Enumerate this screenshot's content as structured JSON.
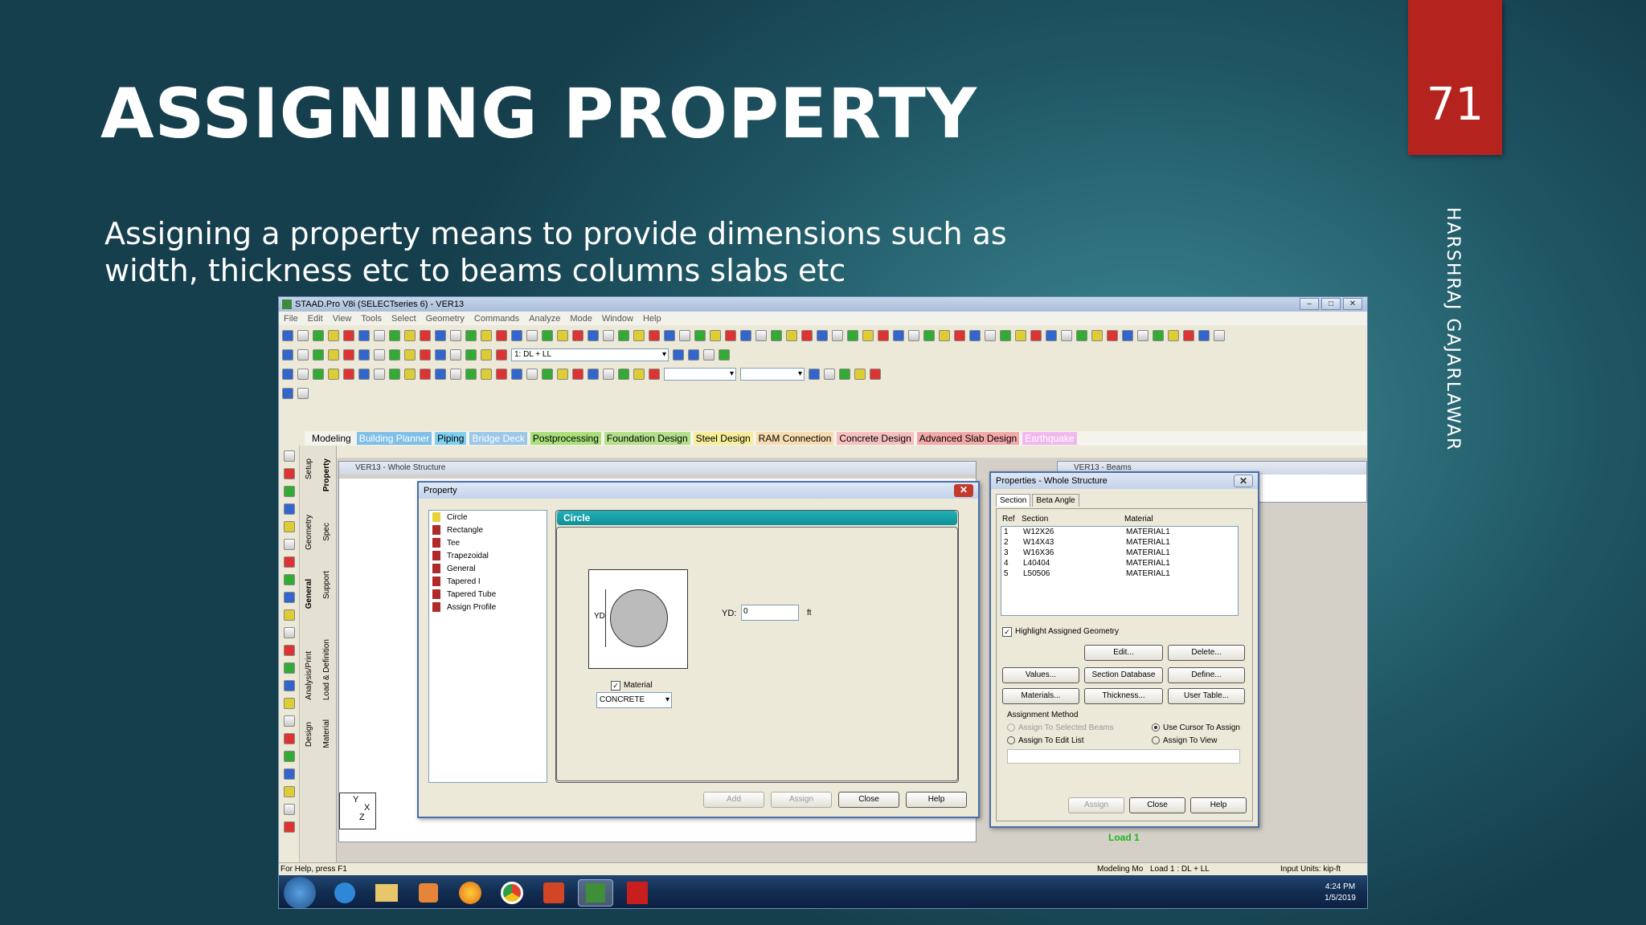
{
  "slide": {
    "title": "ASSIGNING PROPERTY",
    "page_number": "71",
    "body": "Assigning a property means to provide dimensions such as width, thickness etc to beams columns slabs etc",
    "author": "HARSHRAJ GAJARLAWAR"
  },
  "app": {
    "title": "STAAD.Pro V8i (SELECTseries 6) - VER13",
    "menu": [
      "File",
      "Edit",
      "View",
      "Tools",
      "Select",
      "Geometry",
      "Commands",
      "Analyze",
      "Mode",
      "Window",
      "Help"
    ],
    "load_combo": "1: DL + LL",
    "page_tabs": [
      {
        "label": "Modeling",
        "color": "#f4f3ec",
        "text": "#000"
      },
      {
        "label": "Building Planner",
        "color": "#7fbfe8",
        "text": "#fff"
      },
      {
        "label": "Piping",
        "color": "#7fd0f0",
        "text": "#000"
      },
      {
        "label": "Bridge Deck",
        "color": "#9bc7e8",
        "text": "#fff"
      },
      {
        "label": "Postprocessing",
        "color": "#a9e07a",
        "text": "#000"
      },
      {
        "label": "Foundation Design",
        "color": "#b3e08a",
        "text": "#000"
      },
      {
        "label": "Steel Design",
        "color": "#f6ee98",
        "text": "#000"
      },
      {
        "label": "RAM Connection",
        "color": "#f6dcb0",
        "text": "#000"
      },
      {
        "label": "Concrete Design",
        "color": "#f7c0c0",
        "text": "#000"
      },
      {
        "label": "Advanced Slab Design",
        "color": "#f3a9a9",
        "text": "#000"
      },
      {
        "label": "Earthquake",
        "color": "#f1b8f0",
        "text": "#fff"
      }
    ],
    "side_tabs": [
      "Setup",
      "Geometry",
      "General",
      "Analysis/Print",
      "Design",
      "Property",
      "Spec",
      "Support",
      "Load & Definition",
      "Material"
    ],
    "viewport1_title": "VER13 - Whole Structure",
    "viewport2_title": "VER13 - Beams",
    "axis_labels": {
      "y": "Y",
      "x": "X",
      "z": "Z"
    },
    "load_label": "Load 1",
    "status": {
      "help": "For Help, press F1",
      "mode": "Modeling Mo",
      "load": "Load 1 : DL + LL",
      "units": "Input Units:  kip-ft"
    }
  },
  "property_dialog": {
    "title": "Property",
    "shapes": [
      "Circle",
      "Rectangle",
      "Tee",
      "Trapezoidal",
      "General",
      "Tapered I",
      "Tapered Tube",
      "Assign Profile"
    ],
    "selected_header": "Circle",
    "yd_label": "YD:",
    "yd_value": "0",
    "yd_unit": "ft",
    "diagram_label": "YD",
    "material_label": "Material",
    "material_value": "CONCRETE",
    "buttons": {
      "add": "Add",
      "assign": "Assign",
      "close": "Close",
      "help": "Help"
    }
  },
  "properties_panel": {
    "title": "Properties - Whole Structure",
    "tabs": [
      "Section",
      "Beta Angle"
    ],
    "columns": [
      "Ref",
      "Section",
      "Material"
    ],
    "rows": [
      {
        "ref": "1",
        "section": "W12X26",
        "material": "MATERIAL1"
      },
      {
        "ref": "2",
        "section": "W14X43",
        "material": "MATERIAL1"
      },
      {
        "ref": "3",
        "section": "W16X36",
        "material": "MATERIAL1"
      },
      {
        "ref": "4",
        "section": "L40404",
        "material": "MATERIAL1"
      },
      {
        "ref": "5",
        "section": "L50506",
        "material": "MATERIAL1"
      }
    ],
    "highlight_label": "Highlight Assigned Geometry",
    "buttons": {
      "edit": "Edit...",
      "delete": "Delete...",
      "values": "Values...",
      "section_db": "Section Database",
      "define": "Define...",
      "materials": "Materials...",
      "thickness": "Thickness...",
      "user_table": "User Table...",
      "assign": "Assign",
      "close": "Close",
      "help": "Help"
    },
    "assignment_method": "Assignment Method",
    "options": {
      "selected_beams": "Assign To Selected Beams",
      "cursor": "Use Cursor To Assign",
      "edit_list": "Assign To Edit List",
      "view": "Assign To View"
    }
  },
  "taskbar": {
    "time": "4:24 PM",
    "date": "1/5/2019"
  }
}
